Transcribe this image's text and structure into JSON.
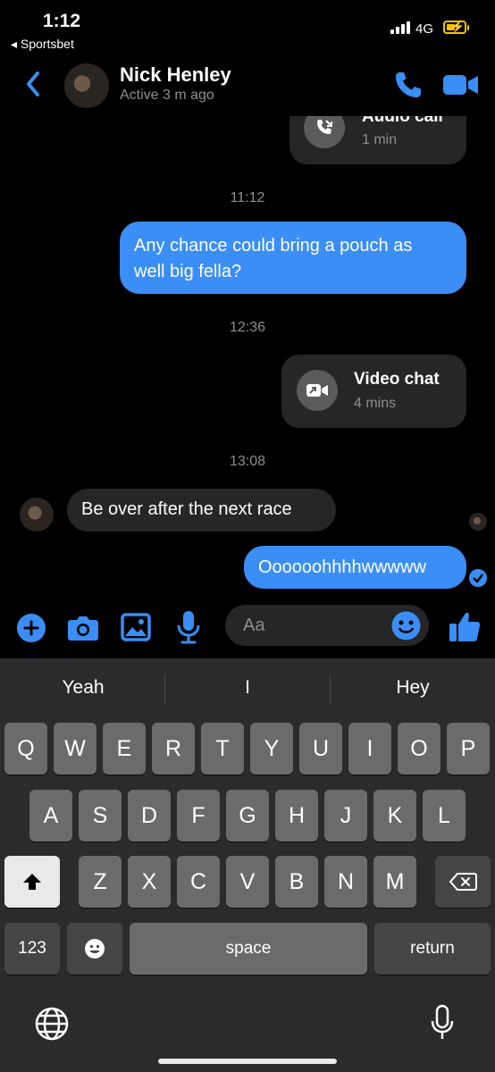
{
  "status_bar": {
    "time": "1:12",
    "back_app": "◂ Sportsbet",
    "network": "4G"
  },
  "header": {
    "name": "Nick Henley",
    "status": "Active 3 m ago"
  },
  "messages": {
    "audio_call": {
      "title": "Audio call",
      "duration": "1 min"
    },
    "stamp1": "11:12",
    "msg1_line1": "Any chance could bring a pouch as",
    "msg1_line2": "well big fella?",
    "stamp2": "12:36",
    "video_chat": {
      "title": "Video chat",
      "duration": "4 mins"
    },
    "stamp3": "13:08",
    "msg2": "Be over after the next race",
    "msg3": "Oooooohhhhwwwww"
  },
  "composer": {
    "placeholder": "Aa"
  },
  "keyboard": {
    "suggestions": [
      "Yeah",
      "I",
      "Hey"
    ],
    "row1": [
      "Q",
      "W",
      "E",
      "R",
      "T",
      "Y",
      "U",
      "I",
      "O",
      "P"
    ],
    "row2": [
      "A",
      "S",
      "D",
      "F",
      "G",
      "H",
      "J",
      "K",
      "L"
    ],
    "row3": [
      "Z",
      "X",
      "C",
      "V",
      "B",
      "N",
      "M"
    ],
    "numbers_key": "123",
    "space_key": "space",
    "return_key": "return"
  },
  "colors": {
    "accent": "#3a8ef6",
    "background": "#000000",
    "bubble_in": "#262628"
  }
}
